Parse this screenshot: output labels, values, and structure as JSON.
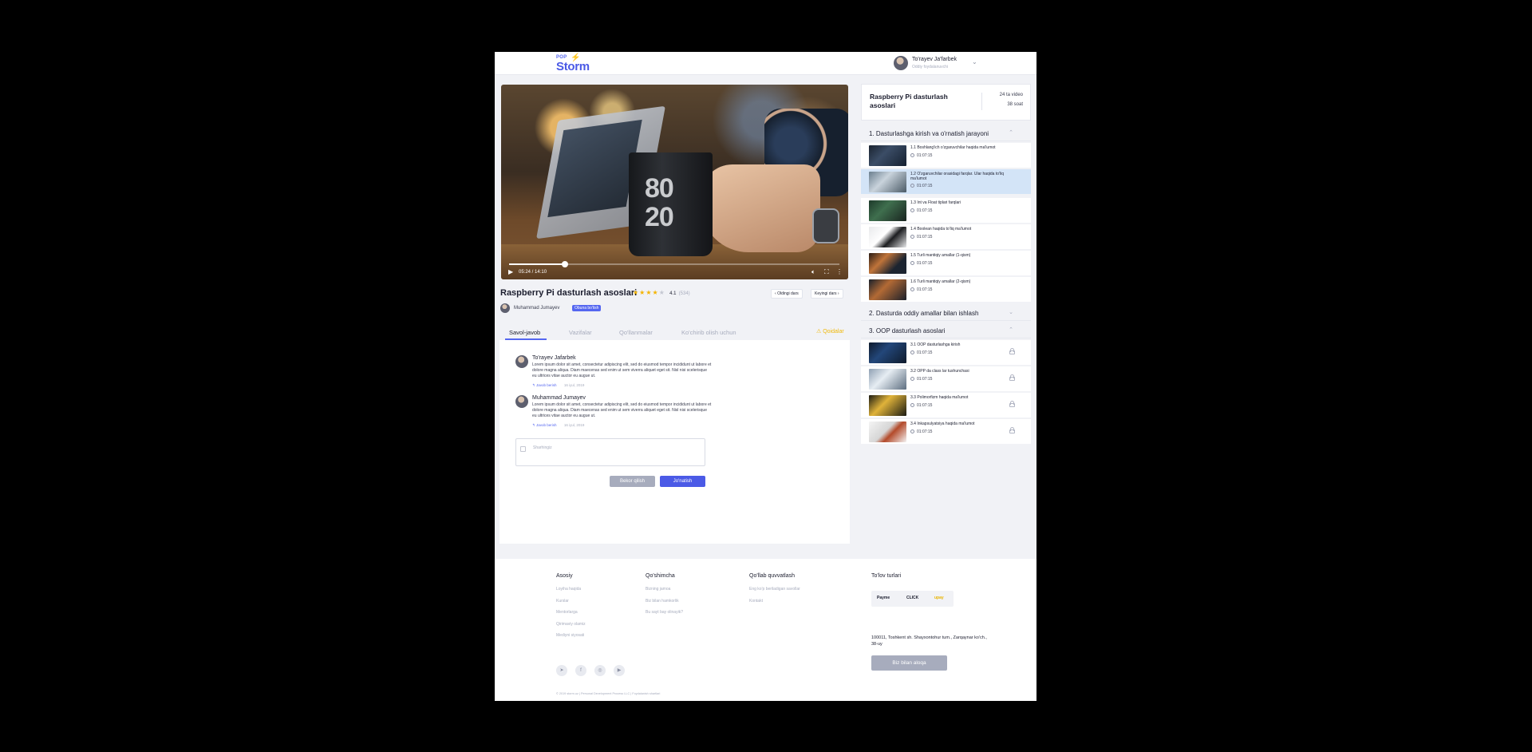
{
  "header": {
    "logo_top": "POP",
    "logo_main": "Storm",
    "user_name": "To'rayev Ja'farbek",
    "user_role": "Oddiy foydalanuvchi"
  },
  "player": {
    "current_time": "05:24 / 14:10",
    "progress_fraction": 0.17,
    "buffered_fraction": 0.22
  },
  "course": {
    "title": "Raspberry Pi dasturlash asoslari",
    "rating_value": "4.1",
    "rating_count": "(534)",
    "stars_filled": 4,
    "prev_label": "Oldingi dars",
    "next_label": "Keyingi dars",
    "author": "Muhammad Jumayev",
    "subscribe": "Obuna bo'lish"
  },
  "tabs": {
    "qa": "Savol-javob",
    "tasks": "Vazifalar",
    "guides": "Qo'llanmalar",
    "download": "Ko'chirib olish uchun",
    "warning": "Qoidalar"
  },
  "comments": [
    {
      "name": "To'rayev Jafarbek",
      "text": "Lorem ipsum dolor sit amet, consectetur adipiscing elit, sed do eiusmod tempor incididunt ut labore et dolore magna aliqua. Diam maecenas sed enim ut sem viverra aliquet eget sit. Nisl nisi scelerisque eu ultrices vitae auctor eu augue ut.",
      "reply": "↰ Javob berish",
      "date": "16 iyul, 2019"
    },
    {
      "name": "Muhammad Jumayev",
      "text": "Lorem ipsum dolor sit amet, consectetur adipiscing elit, sed do eiusmod tempor incididunt ut labore et dolore magna aliqua. Diam maecenas sed enim ut sem viverra aliquet eget sit. Nisl nisi scelerisque eu ultrices vitae auctor eu augue ut.",
      "reply": "↰ Javob berish",
      "date": "16 iyul, 2019"
    }
  ],
  "comment_form": {
    "placeholder": "Sharhingiz",
    "cancel": "Bekor qilish",
    "submit": "Jo'natish"
  },
  "sidebar": {
    "title": "Raspberry Pi dasturlash asoslari",
    "videos": "24 ta video",
    "hours": "38 soat",
    "sections": [
      {
        "title": "1. Dasturlashga kirish va o'rnatish jarayoni",
        "expanded": true,
        "items": [
          {
            "label": "1.1 Boshlang'ich o'zgaruvchilar haqida ma'lumot",
            "duration": "01:07:15",
            "active": false,
            "locked": false
          },
          {
            "label": "1.2 O'zgaruvchilar orasidagi farqlar. Ular haqida to'liq ma'lumot",
            "duration": "01:07:15",
            "active": true,
            "locked": false
          },
          {
            "label": "1.3 Int va Float tiplari farqlari",
            "duration": "01:07:15",
            "active": false,
            "locked": false
          },
          {
            "label": "1.4 Boolean haqida to'liq ma'lumot",
            "duration": "01:07:15",
            "active": false,
            "locked": false
          },
          {
            "label": "1.5 Turli mantiqiy amallar (1-qism)",
            "duration": "01:07:15",
            "active": false,
            "locked": false
          },
          {
            "label": "1.6 Turli mantiqiy amallar (2-qism)",
            "duration": "01:07:15",
            "active": false,
            "locked": false
          }
        ]
      },
      {
        "title": "2. Dasturda oddiy amallar bilan ishlash",
        "expanded": false,
        "items": []
      },
      {
        "title": "3. OOP dasturlash asoslari",
        "expanded": true,
        "items": [
          {
            "label": "3.1 OOP dasturlashga kirish",
            "duration": "01:07:15",
            "active": false,
            "locked": true
          },
          {
            "label": "3.2 OPP da class lar tushunchasi",
            "duration": "01:07:15",
            "active": false,
            "locked": true
          },
          {
            "label": "3.3 Polimorfizm haqida ma'lumot",
            "duration": "01:07:15",
            "active": false,
            "locked": true
          },
          {
            "label": "3.4 Inkapsulyatsiya haqida ma'lumot",
            "duration": "01:07:15",
            "active": false,
            "locked": true
          }
        ]
      }
    ]
  },
  "footer": {
    "col1": {
      "title": "Asosiy",
      "links": [
        "Loyiha haqida",
        "Kurslar",
        "Mentorlarga",
        "Qirimaviy olamiz",
        "Mediyni siyosati"
      ]
    },
    "col2": {
      "title": "Qo'shimcha",
      "links": [
        "Bizning jamoa",
        "Biz bilan hamkorlik",
        "Bu sayt bay olinayik?"
      ]
    },
    "col3": {
      "title": "Qo'llab quvvatlash",
      "links": [
        "Eng ko'p beriladigan savollar",
        "Kontakt"
      ]
    },
    "col4": {
      "title": "To'lov turlari"
    },
    "payments": [
      "Payme",
      "CLICK",
      "upay"
    ],
    "address": "100011, Toshkent sh. Shayxontohur tum., Zarqaynar ko'ch., 38-uy",
    "contact_button": "Biz bilan aloqa",
    "copyright": "© 2019 storm.uz   |   Personal Development Process LLC   |   Foydalanish shartlari"
  },
  "colors": {
    "accent": "#5567f0",
    "star": "#f4b400",
    "warning": "#f0b90b",
    "active_item": "#d3e4f7"
  }
}
